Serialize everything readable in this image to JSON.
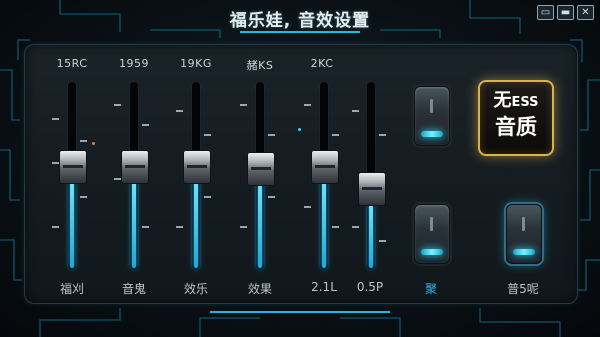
{
  "window": {
    "title": "福乐娃, 音效设置",
    "controls": [
      "▭",
      "▬",
      "✕"
    ]
  },
  "sliders": [
    {
      "freq": "15RC",
      "label": "福刈",
      "level": 0.52
    },
    {
      "freq": "1959",
      "label": "音鬼",
      "level": 0.52
    },
    {
      "freq": "19KG",
      "label": "效乐",
      "level": 0.52
    },
    {
      "freq": "赭KS",
      "label": "效果",
      "level": 0.51
    },
    {
      "freq": "2KC",
      "label": "2.1L",
      "level": 0.52
    },
    {
      "freq": "",
      "label": "0.5P",
      "level": 0.38
    }
  ],
  "switches": [
    {
      "label": "",
      "state": "off"
    },
    {
      "label": "聚",
      "state": "off"
    },
    {
      "label": "普5呢",
      "state": "on"
    }
  ],
  "ess_button": {
    "line1_a": "无",
    "line1_b": "ESS",
    "line2": "音质"
  },
  "colors": {
    "accent": "#2fb4e6",
    "gold": "#d8b34a",
    "text": "#c9d3d8"
  }
}
